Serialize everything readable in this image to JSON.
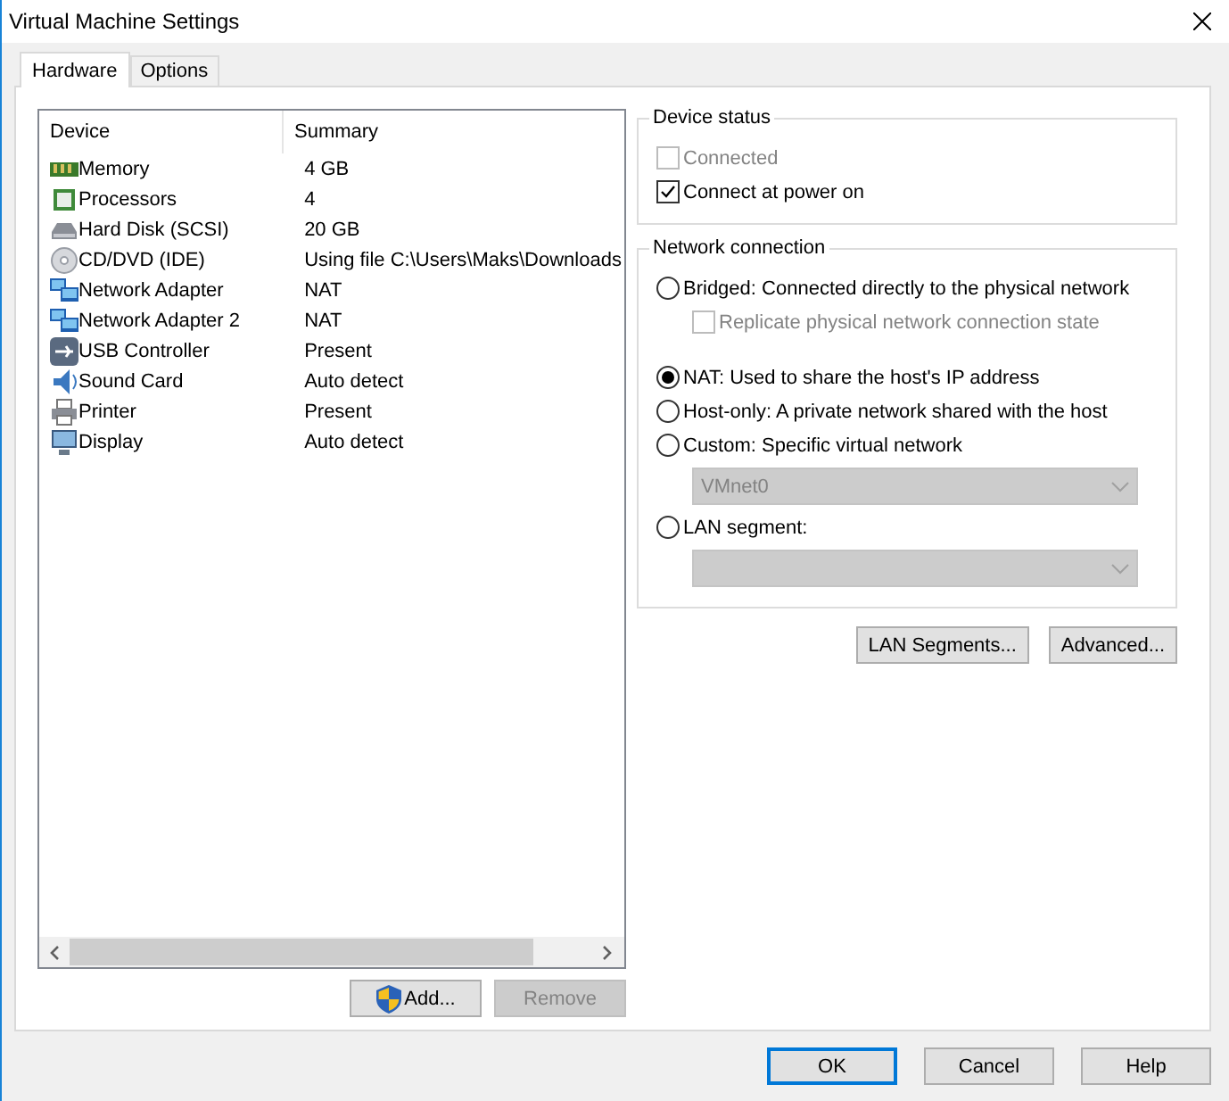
{
  "window": {
    "title": "Virtual Machine Settings"
  },
  "tabs": [
    {
      "label": "Hardware",
      "selected": true
    },
    {
      "label": "Options",
      "selected": false
    }
  ],
  "devices": {
    "columns": [
      "Device",
      "Summary"
    ],
    "rows": [
      {
        "kind": "memory",
        "device": "Memory",
        "summary": "4 GB"
      },
      {
        "kind": "cpu",
        "device": "Processors",
        "summary": "4"
      },
      {
        "kind": "disk",
        "device": "Hard Disk (SCSI)",
        "summary": "20 GB"
      },
      {
        "kind": "cd",
        "device": "CD/DVD (IDE)",
        "summary": "Using file C:\\Users\\Maks\\Downloads"
      },
      {
        "kind": "network",
        "device": "Network Adapter",
        "summary": "NAT"
      },
      {
        "kind": "network",
        "device": "Network Adapter 2",
        "summary": "NAT"
      },
      {
        "kind": "usb",
        "device": "USB Controller",
        "summary": "Present"
      },
      {
        "kind": "sound",
        "device": "Sound Card",
        "summary": "Auto detect"
      },
      {
        "kind": "printer",
        "device": "Printer",
        "summary": "Present"
      },
      {
        "kind": "display",
        "device": "Display",
        "summary": "Auto detect"
      }
    ]
  },
  "list_buttons": [
    {
      "label": "Add...",
      "disabled": false,
      "shield": true
    },
    {
      "label": "Remove",
      "disabled": true,
      "shield": false
    }
  ],
  "device_status": {
    "title": "Device status",
    "options": [
      {
        "label": "Connected",
        "checked": false,
        "disabled": true
      },
      {
        "label": "Connect at power on",
        "checked": true,
        "disabled": false
      }
    ]
  },
  "network_connection": {
    "title": "Network connection",
    "items": [
      {
        "kind": "radio",
        "label": "Bridged: Connected directly to the physical network",
        "selected": false
      },
      {
        "kind": "checkbox",
        "label": "Replicate physical network connection state",
        "checked": false,
        "disabled": true
      },
      {
        "kind": "radio",
        "label": "NAT: Used to share the host's IP address",
        "selected": true
      },
      {
        "kind": "radio",
        "label": "Host-only: A private network shared with the host",
        "selected": false
      },
      {
        "kind": "radio",
        "label": "Custom: Specific virtual network",
        "selected": false
      },
      {
        "kind": "select",
        "value": "VMnet0",
        "disabled": true
      },
      {
        "kind": "radio",
        "label": "LAN segment:",
        "selected": false
      },
      {
        "kind": "select",
        "disabled": true
      }
    ]
  },
  "network_buttons": [
    "LAN Segments...",
    "Advanced..."
  ],
  "dialog_buttons": [
    {
      "label": "OK",
      "default": true
    },
    {
      "label": "Cancel",
      "default": false
    },
    {
      "label": "Help",
      "default": false
    }
  ]
}
